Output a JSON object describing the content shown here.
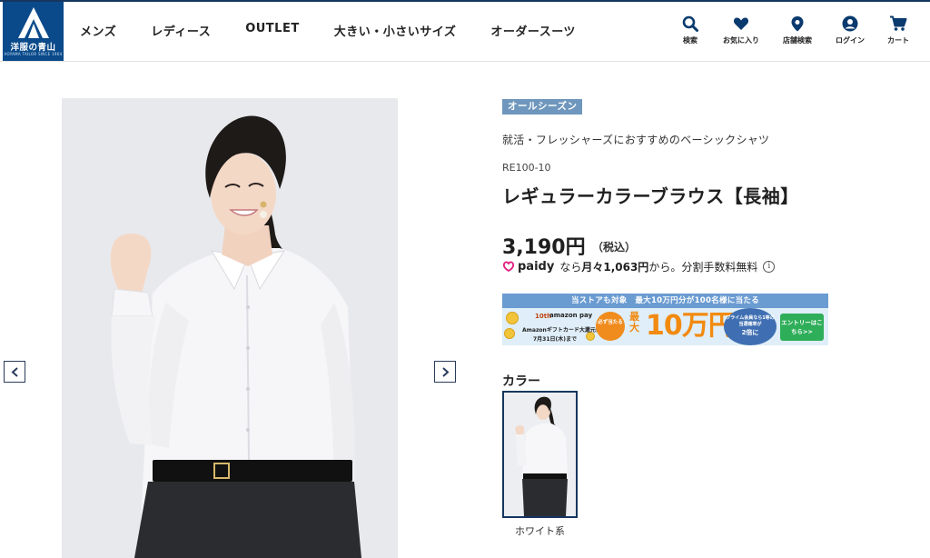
{
  "header": {
    "logo_text": "洋服の青山",
    "logo_sub": "AOYAMA TAILOR SINCE 1964",
    "nav": [
      "メンズ",
      "レディース",
      "OUTLET",
      "大きい・小さいサイズ",
      "オーダースーツ"
    ],
    "icons": [
      {
        "icon": "search-icon",
        "label": "検索"
      },
      {
        "icon": "heart-icon",
        "label": "お気に入り"
      },
      {
        "icon": "map-pin-icon",
        "label": "店舗検索"
      },
      {
        "icon": "user-icon",
        "label": "ログイン"
      },
      {
        "icon": "cart-icon",
        "label": "カート"
      }
    ]
  },
  "product": {
    "season_tag": "オールシーズン",
    "catch_copy": "就活・フレッシャーズにおすすめのベーシックシャツ",
    "sku": "RE100-10",
    "title": "レギュラーカラーブラウス【長袖】",
    "price": "3,190円",
    "tax": "（税込）",
    "paidy": {
      "logo": "paidy",
      "prefix": "なら",
      "monthly": "月々1,063円",
      "suffix": "から。分割手数料無料"
    }
  },
  "banner": {
    "top": "当ストアも対象　最大10万円分が100名様に当たる",
    "anniv": "10th",
    "amazon": "amazon pay",
    "gift": "Amazonギフトカード大還元祭",
    "date": "7月31日(木)まで",
    "badge": "必ず当たる",
    "max": "最大",
    "big": "10万円",
    "circle": "プライム会員なら1等の当選確率が",
    "circle_x2": "2倍に",
    "entry": "エントリーはこちら>>"
  },
  "colors": {
    "label": "カラー",
    "options": [
      {
        "name": "ホワイト系"
      }
    ]
  },
  "theme": {
    "brand_navy": "#16365f",
    "logo_blue": "#0a4a8a",
    "tag_blue": "#6f97bd"
  }
}
